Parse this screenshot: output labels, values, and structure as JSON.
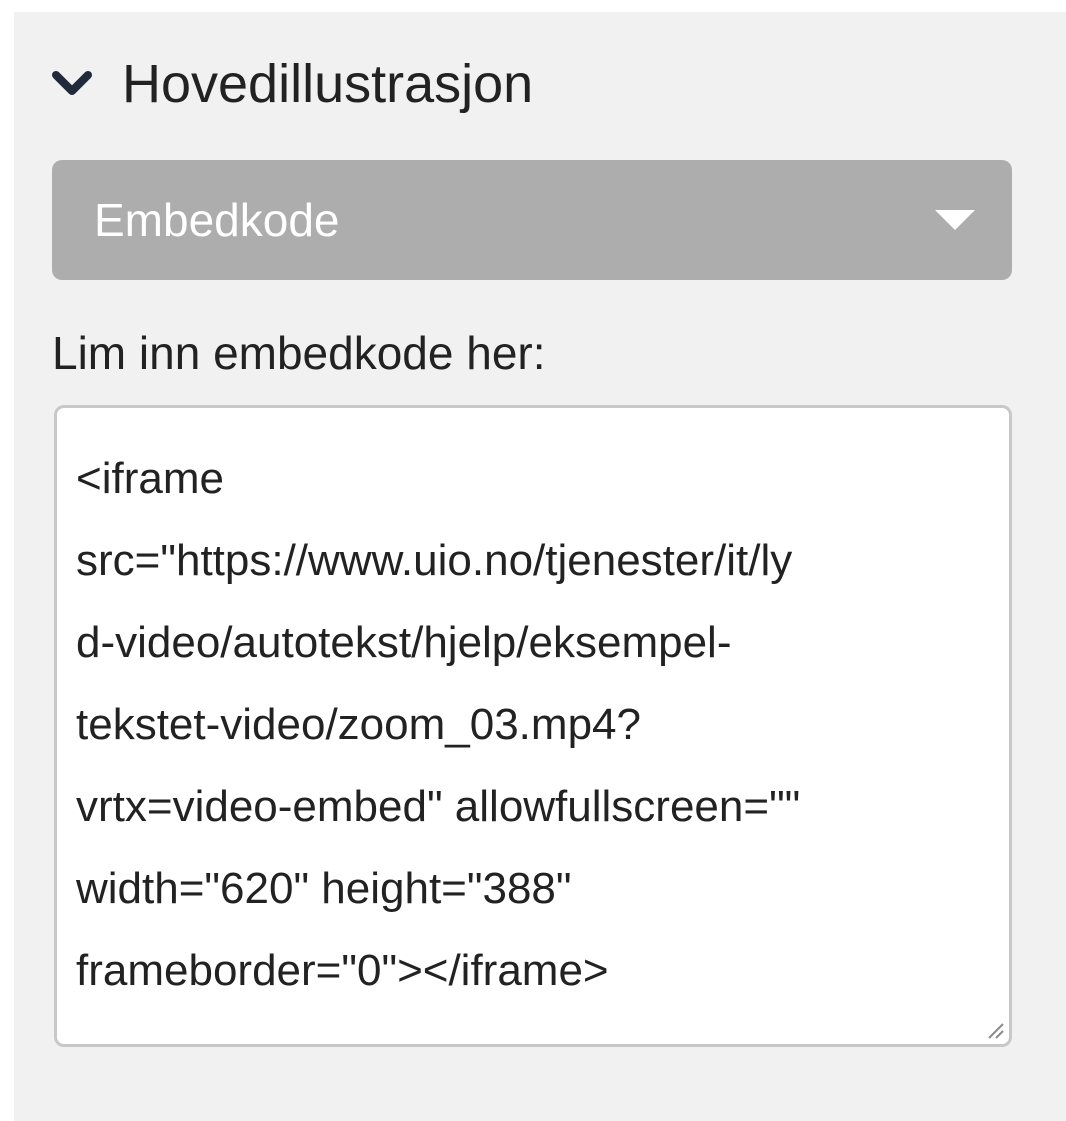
{
  "section": {
    "title": "Hovedillustrasjon",
    "expanded_icon": "chevron-down-icon"
  },
  "media_type_select": {
    "value": "Embedkode",
    "icon": "caret-down-icon"
  },
  "embed_field": {
    "label": "Lim inn embedkode her:",
    "lines": [
      "<iframe",
      "src=\"https://www.uio.no/tjenester/it/ly",
      "d-video/autotekst/hjelp/eksempel-",
      "tekstet-video/zoom_03.mp4?",
      "vrtx=video-embed\" allowfullscreen=\"\"",
      "width=\"620\" height=\"388\"",
      "frameborder=\"0\"></iframe>"
    ]
  },
  "colors": {
    "panel_background": "#f1f1f1",
    "select_background": "#adadad",
    "text": "#222222",
    "textarea_border": "#c8c8c8"
  }
}
